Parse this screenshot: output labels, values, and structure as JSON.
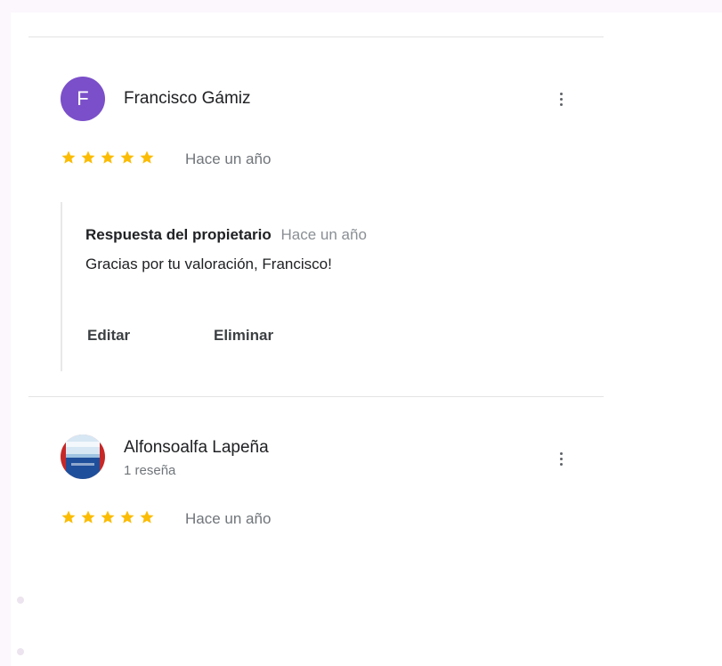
{
  "colors": {
    "page_background": "#fbf7fd",
    "star": "#fbbc04",
    "avatar_purple": "#7b4fc9",
    "divider": "#e3e3e3"
  },
  "reviews": [
    {
      "avatar_letter": "F",
      "name": "Francisco Gámiz",
      "rating": 5,
      "time": "Hace un año",
      "menu_icon": "more-vert-icon",
      "owner_reply": {
        "title": "Respuesta del propietario",
        "time": "Hace un año",
        "text": "Gracias por tu valoración, Francisco!",
        "edit_label": "Editar",
        "delete_label": "Eliminar"
      }
    },
    {
      "avatar_icon": "profile-photo",
      "name": "Alfonsoalfa Lapeña",
      "subtitle": "1 reseña",
      "rating": 5,
      "time": "Hace un año",
      "menu_icon": "more-vert-icon"
    }
  ]
}
